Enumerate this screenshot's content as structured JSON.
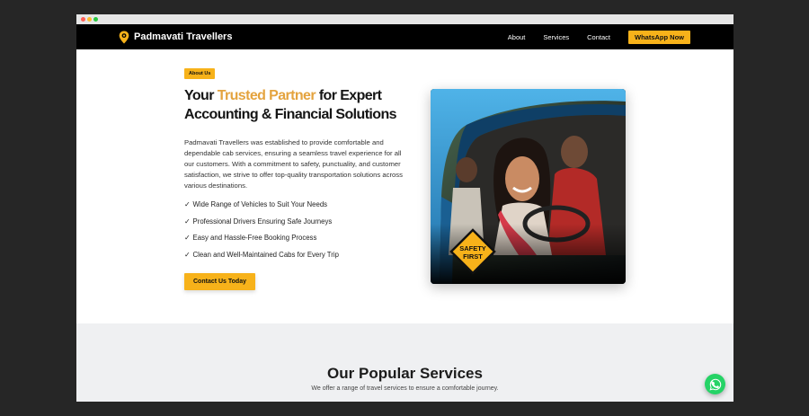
{
  "brand": {
    "name": "Padmavati Travellers",
    "icon": "location-pin-icon"
  },
  "nav": {
    "links": [
      "About",
      "Services",
      "Contact"
    ],
    "whatsapp_label": "WhatsApp Now"
  },
  "about": {
    "badge": "About Us",
    "headline_prefix": "Your ",
    "headline_highlight": "Trusted Partner",
    "headline_suffix": " for Expert Accounting & Financial Solutions",
    "description": "Padmavati Travellers was established to provide comfortable and dependable cab services, ensuring a seamless travel experience for all our customers. With a commitment to safety, punctuality, and customer satisfaction, we strive to offer top-quality transportation solutions across various destinations.",
    "features": [
      "Wide Range of Vehicles to Suit Your Needs",
      "Professional Drivers Ensuring Safe Journeys",
      "Easy and Hassle-Free Booking Process",
      "Clean and Well-Maintained Cabs for Every Trip"
    ],
    "check_mark": "✓",
    "cta_label": "Contact Us Today",
    "image_sign": [
      "SAFETY",
      "FIRST"
    ]
  },
  "services": {
    "title": "Our Popular Services",
    "subtitle": "We offer a range of travel services to ensure a comfortable journey."
  },
  "colors": {
    "accent": "#f7b21a",
    "highlight": "#e4a33e",
    "whatsapp": "#25d366",
    "nav_bg": "#000000"
  }
}
